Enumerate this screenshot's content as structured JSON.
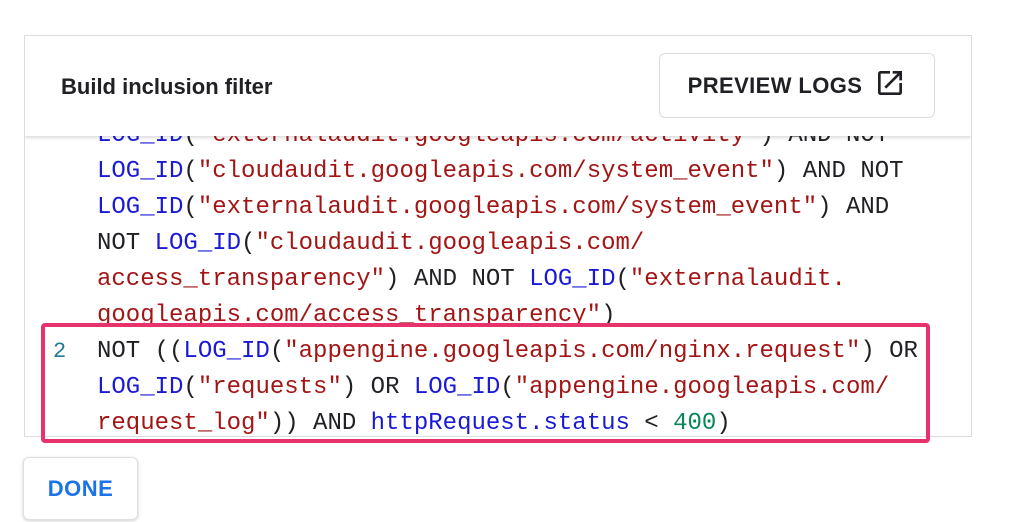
{
  "header": {
    "title": "Build inclusion filter",
    "preview_button": {
      "label": "PREVIEW LOGS",
      "icon": "open-in-new-icon"
    }
  },
  "editor": {
    "lines": [
      {
        "number": "",
        "tokens": [
          {
            "t": "LOG_ID",
            "k": "fn"
          },
          {
            "t": "(",
            "k": "kw"
          },
          {
            "t": "\"externalaudit.googleapis.com/activity\"",
            "k": "str"
          },
          {
            "t": ") AND NOT",
            "k": "kw"
          }
        ]
      },
      {
        "number": "",
        "tokens": [
          {
            "t": "LOG_ID",
            "k": "fn"
          },
          {
            "t": "(",
            "k": "kw"
          },
          {
            "t": "\"cloudaudit.googleapis.com/system_event\"",
            "k": "str"
          },
          {
            "t": ") AND NOT",
            "k": "kw"
          }
        ]
      },
      {
        "number": "",
        "tokens": [
          {
            "t": "LOG_ID",
            "k": "fn"
          },
          {
            "t": "(",
            "k": "kw"
          },
          {
            "t": "\"externalaudit.googleapis.com/system_event\"",
            "k": "str"
          },
          {
            "t": ") AND",
            "k": "kw"
          }
        ]
      },
      {
        "number": "",
        "tokens": [
          {
            "t": "NOT ",
            "k": "kw"
          },
          {
            "t": "LOG_ID",
            "k": "fn"
          },
          {
            "t": "(",
            "k": "kw"
          },
          {
            "t": "\"cloudaudit.googleapis.com/",
            "k": "str"
          }
        ]
      },
      {
        "number": "",
        "tokens": [
          {
            "t": "access_transparency\"",
            "k": "str"
          },
          {
            "t": ") AND NOT ",
            "k": "kw"
          },
          {
            "t": "LOG_ID",
            "k": "fn"
          },
          {
            "t": "(",
            "k": "kw"
          },
          {
            "t": "\"externalaudit.",
            "k": "str"
          }
        ]
      },
      {
        "number": "",
        "tokens": [
          {
            "t": "googleapis.com/access_transparency\"",
            "k": "str"
          },
          {
            "t": ")",
            "k": "kw"
          }
        ]
      },
      {
        "number": "2",
        "tokens": [
          {
            "t": "NOT ((",
            "k": "kw"
          },
          {
            "t": "LOG_ID",
            "k": "fn"
          },
          {
            "t": "(",
            "k": "kw"
          },
          {
            "t": "\"appengine.googleapis.com/nginx.request\"",
            "k": "str"
          },
          {
            "t": ") OR",
            "k": "kw"
          }
        ]
      },
      {
        "number": "",
        "tokens": [
          {
            "t": "LOG_ID",
            "k": "fn"
          },
          {
            "t": "(",
            "k": "kw"
          },
          {
            "t": "\"requests\"",
            "k": "str"
          },
          {
            "t": ") OR ",
            "k": "kw"
          },
          {
            "t": "LOG_ID",
            "k": "fn"
          },
          {
            "t": "(",
            "k": "kw"
          },
          {
            "t": "\"appengine.googleapis.com/",
            "k": "str"
          }
        ]
      },
      {
        "number": "",
        "tokens": [
          {
            "t": "request_log\"",
            "k": "str"
          },
          {
            "t": ")) AND ",
            "k": "kw"
          },
          {
            "t": "httpRequest.status",
            "k": "fn"
          },
          {
            "t": " < ",
            "k": "kw"
          },
          {
            "t": "400",
            "k": "num"
          },
          {
            "t": ")",
            "k": "kw"
          }
        ]
      }
    ]
  },
  "footer": {
    "done_label": "DONE"
  },
  "colors": {
    "highlight": "#e8326b",
    "accent": "#1a73e8",
    "function": "#1a1ad6",
    "string": "#a31515",
    "number": "#098658"
  }
}
